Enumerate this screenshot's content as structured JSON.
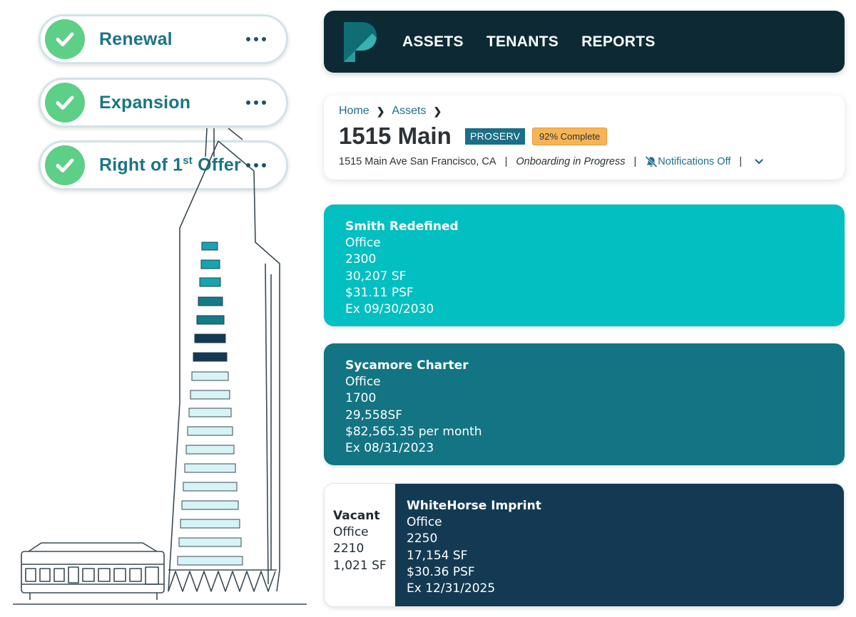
{
  "options": [
    {
      "label": "Renewal",
      "checked": true
    },
    {
      "label": "Expansion",
      "checked": true
    },
    {
      "label_main": "Right of 1",
      "label_sup": "st",
      "label_end": " Offer",
      "checked": true
    }
  ],
  "nav": {
    "links": [
      "ASSETS",
      "TENANTS",
      "REPORTS"
    ]
  },
  "asset": {
    "breadcrumb": [
      "Home",
      "Assets"
    ],
    "title": "1515 Main",
    "badge": "PROSERV",
    "progress_label": "92% Complete",
    "address": "1515 Main Ave  San Francisco, CA",
    "status": "Onboarding in Progress",
    "notifications": "Notifications Off"
  },
  "tenants": [
    {
      "name": "Smith Redefined",
      "type": "Office",
      "suite": "2300",
      "area": "30,207 SF",
      "rent": "$31.11 PSF",
      "expiry": "Ex 09/30/2030",
      "color": "#02bfc1"
    },
    {
      "name": "Sycamore Charter",
      "type": "Office",
      "suite": "1700",
      "area": "29,558SF",
      "rent": "$82,565.35 per month",
      "expiry": "Ex 08/31/2023",
      "color": "#137483"
    },
    {
      "name": "WhiteHorse Imprint",
      "type": "Office",
      "suite": "2250",
      "area": "17,154 SF",
      "rent": "$30.36 PSF",
      "expiry": "Ex 12/31/2025",
      "color": "#143a53"
    }
  ],
  "vacant": {
    "name": "Vacant",
    "type": "Office",
    "suite": "2210",
    "area": "1,021 SF"
  },
  "colors": {
    "brand_dark": "#0d2a34",
    "check_green": "#5dcf86",
    "accent_teal": "#1a7583",
    "progress_orange": "#f7b457"
  }
}
